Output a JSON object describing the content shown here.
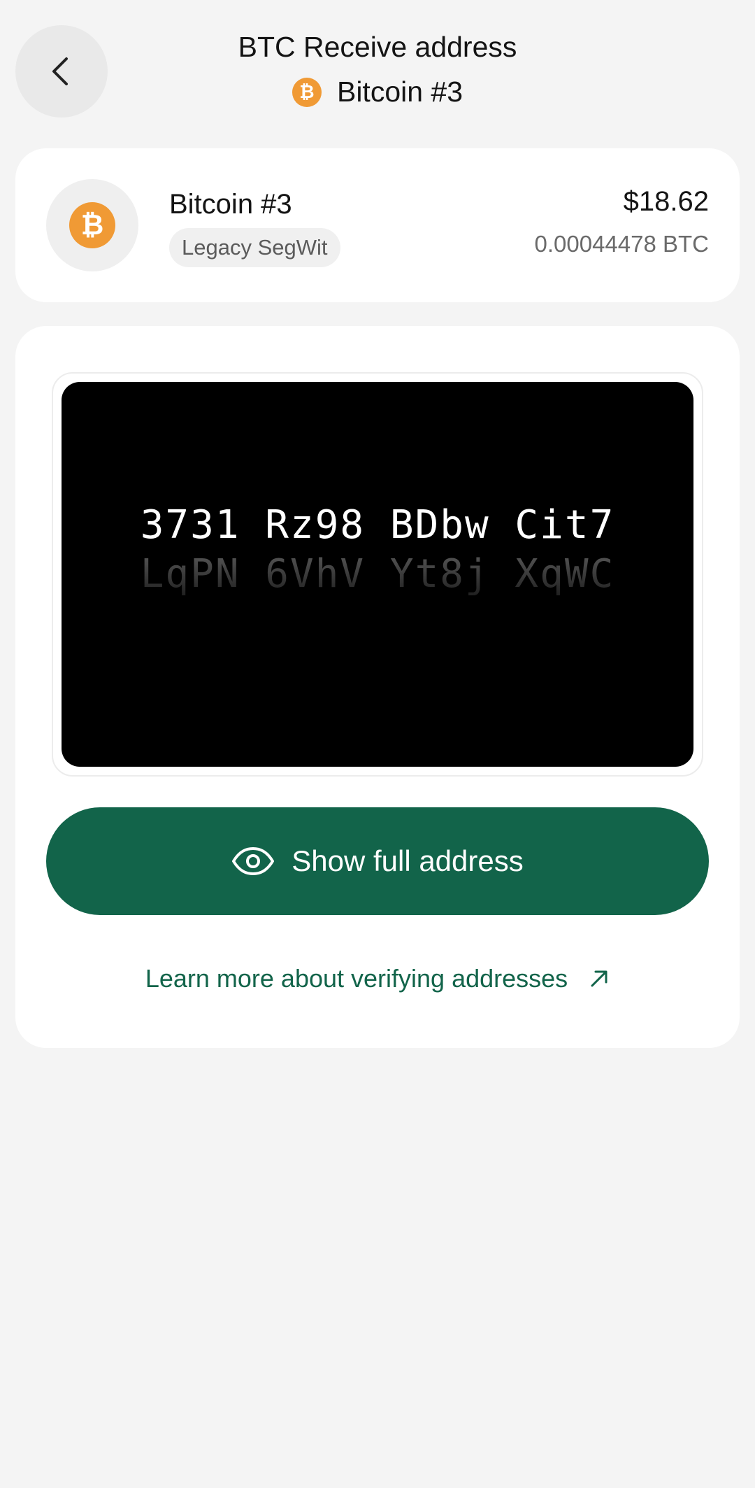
{
  "header": {
    "title": "BTC Receive address",
    "account_label": "Bitcoin #3",
    "back_icon": "chevron-left-icon"
  },
  "account": {
    "name": "Bitcoin #3",
    "badge": "Legacy SegWit",
    "fiat_balance": "$18.62",
    "crypto_balance": "0.00044478 BTC",
    "icon": "bitcoin-icon",
    "icon_color": "#f09a35"
  },
  "address": {
    "line1": "3731 Rz98 BDbw Cit7",
    "line2": "LqPN 6VhV Yt8j XqWC"
  },
  "actions": {
    "show_full_label": "Show full address",
    "show_icon": "eye-icon",
    "learn_more_label": "Learn more about verifying addresses",
    "learn_icon": "arrow-up-right-icon"
  },
  "colors": {
    "accent": "#12644a",
    "background": "#f4f4f4",
    "card": "#ffffff",
    "address_box": "#000000"
  }
}
